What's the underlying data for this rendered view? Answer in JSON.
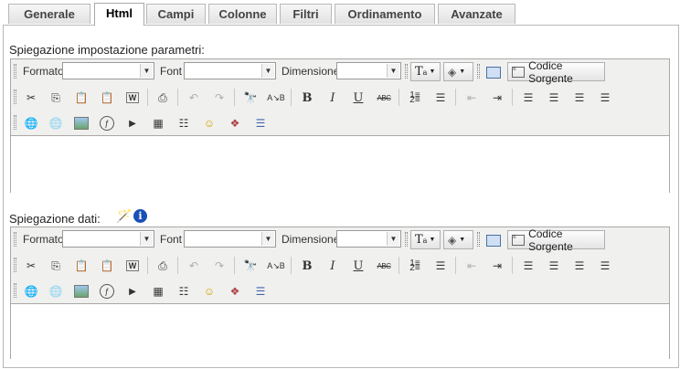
{
  "tabs": [
    {
      "label": "Generale"
    },
    {
      "label": "Html"
    },
    {
      "label": "Campi"
    },
    {
      "label": "Colonne"
    },
    {
      "label": "Filtri"
    },
    {
      "label": "Ordinamento"
    },
    {
      "label": "Avanzate"
    }
  ],
  "active_tab": "Html",
  "sections": [
    {
      "label": "Spiegazione impostazione parametri:"
    },
    {
      "label": "Spiegazione dati:"
    }
  ],
  "toolbar": {
    "format_label": "Formato",
    "font_label": "Font",
    "size_label": "Dimensione",
    "format_value": "",
    "font_value": "",
    "size_value": "",
    "source_label": "Codice Sorgente",
    "icons": {
      "text_color": "text-color-icon",
      "bg_color": "background-color-icon",
      "maximize": "maximize-icon",
      "source": "source-icon",
      "cut": "cut-icon",
      "copy": "copy-icon",
      "paste": "paste-icon",
      "paste_text": "paste-text-icon",
      "paste_word": "paste-word-icon",
      "print": "print-icon",
      "undo": "undo-icon",
      "redo": "redo-icon",
      "find": "find-icon",
      "replace": "replace-icon",
      "bold": "B",
      "italic": "I",
      "underline": "U",
      "strike": "ABC",
      "ordered_list": "ordered-list-icon",
      "unordered_list": "unordered-list-icon",
      "outdent": "outdent-icon",
      "indent": "indent-icon",
      "align_left": "align-left-icon",
      "align_center": "align-center-icon",
      "align_right": "align-right-icon",
      "align_justify": "align-justify-icon",
      "link": "link-icon",
      "unlink": "unlink-icon",
      "image": "image-icon",
      "flash": "flash-icon",
      "media": "media-icon",
      "table": "table-icon",
      "hr": "horizontal-rule-icon",
      "smiley": "smiley-icon",
      "special_char": "special-char-icon",
      "page_break": "page-break-icon"
    }
  },
  "colors": {
    "toolbar_bg": "#f0f0ee",
    "border": "#a8a8a8",
    "info": "#1a4fb8"
  }
}
